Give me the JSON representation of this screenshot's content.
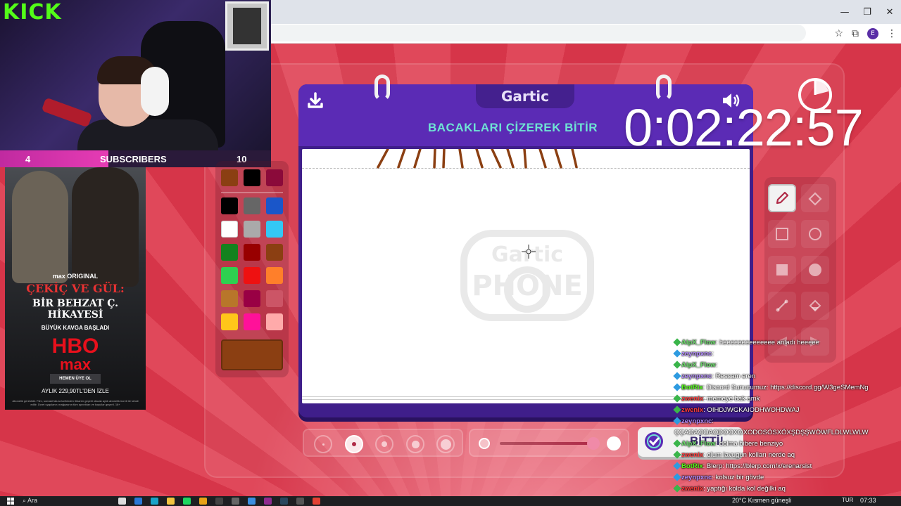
{
  "stream": {
    "brand": "KICK",
    "subscribers": {
      "label": "SUBSCRIBERS",
      "current": "4",
      "goal": "10",
      "progress": 0.4
    }
  },
  "ad": {
    "brand": "max ORIGINAL",
    "title_line1": "ÇEKİÇ VE GÜL:",
    "title_line2": "BİR BEHZAT Ç. HİKAYESİ",
    "tagline": "BÜYÜK KAVGA BAŞLADI",
    "logo_top": "HBO",
    "logo_bottom": "max",
    "cta": "HEMEN ÜYE OL",
    "price": "AYLIK 229,90TL'DEN İZLE",
    "fine_print": "Abonelik gereklidir. Film, sonraki fatura tarihinden itibaren geçerli olacak aylık abonelik ücreti ile tahsil edilir. Ücret uygulanır; mağazanın tüm ayrıntıları ve koşullar geçerli. 18+"
  },
  "game": {
    "brand": "Gartic",
    "prompt": "BACAKLARI ÇİZEREK BİTİR",
    "watermark_top": "Gartic",
    "watermark_bottom": "PHONE",
    "done_label": "BİTTİ!",
    "timer": "0:02:22:57",
    "current_color": "#8b3f12",
    "palette_top": [
      "#8b3f12",
      "#000000",
      "#8b0a3a"
    ],
    "palette": [
      "#000000",
      "#666666",
      "#1a56c9",
      "#ffffff",
      "#aaaaaa",
      "#33c8f5",
      "#14821e",
      "#980000",
      "#8b3f12",
      "#2fd050",
      "#ee1111",
      "#ff7f2a",
      "#b8762a",
      "#990044",
      "#cc5566",
      "#ffc61a",
      "#ff1199",
      "#ffaaaa"
    ],
    "tools": [
      "pencil-icon",
      "eraser-icon",
      "rectangle-outline-icon",
      "circle-outline-icon",
      "rectangle-fill-icon",
      "circle-fill-icon",
      "line-icon",
      "fill-bucket-icon",
      "undo-icon",
      "redo-icon"
    ],
    "brush_size_selected": 2,
    "opacity": 0.95
  },
  "chat": [
    {
      "user": "AlpX_Flow",
      "color": "#6ee06e",
      "badge": "#3ab54a",
      "text": ": heeeeeeeeeeeeee anladı heeeee"
    },
    {
      "user": "zeynpxnc",
      "color": "#b48cff",
      "badge": "#2e9be0",
      "text": ": "
    },
    {
      "user": "AlpX_Flow",
      "color": "#6ee06e",
      "badge": "#3ab54a",
      "text": ": "
    },
    {
      "user": "zeynpxnc",
      "color": "#b48cff",
      "badge": "#2e9be0",
      "text": ": Ressam eren"
    },
    {
      "user": "BotRix",
      "color": "#53fc18",
      "badge": "#2e9be0",
      "text": ": Discord Sunucumuz: https://discord.gg/W3geSMemNg"
    },
    {
      "user": "zwenix",
      "color": "#ff3b3b",
      "badge": "#3ab54a",
      "text": ": memeye bak amk"
    },
    {
      "user": "zwenix",
      "color": "#ff3b3b",
      "badge": "#3ab54a",
      "text": ": OIHDJWGKAIODHWOHDWAJ"
    },
    {
      "user": "zeynpxnc",
      "color": "#b48cff",
      "badge": "#2e9be0",
      "text": ":"
    },
    {
      "user": "",
      "color": "#ffffff",
      "badge": "",
      "text": "ÇÇAOAOOAODOOXOXODOSÖSXÖXŞDŞŞWÖWFLDLWLWLW"
    },
    {
      "user": "AlpX_Flow",
      "color": "#6ee06e",
      "badge": "#3ab54a",
      "text": ": dolma bibere benziyo"
    },
    {
      "user": "zwenix",
      "color": "#ff3b3b",
      "badge": "#3ab54a",
      "text": ": olum lavugun kolları nerde aq"
    },
    {
      "user": "BotRix",
      "color": "#53fc18",
      "badge": "#2e9be0",
      "text": ": Blerp: https://blerp.com/x/erenarsist"
    },
    {
      "user": "zeynpxnc",
      "color": "#b48cff",
      "badge": "#2e9be0",
      "text": ": kolsuz bir gövde"
    },
    {
      "user": "zwenix",
      "color": "#ff3b3b",
      "badge": "#3ab54a",
      "text": ": yaptığı kolda kol değilki aq"
    },
    {
      "user": "zwenix",
      "color": "#ff3b3b",
      "badge": "#3ab54a",
      "text": ": "
    }
  ],
  "taskbar": {
    "search": "Ara",
    "weather": "20°C  Kısmen güneşli",
    "lang": "TUR",
    "time": "07:33"
  },
  "browser": {
    "profile": "E"
  }
}
